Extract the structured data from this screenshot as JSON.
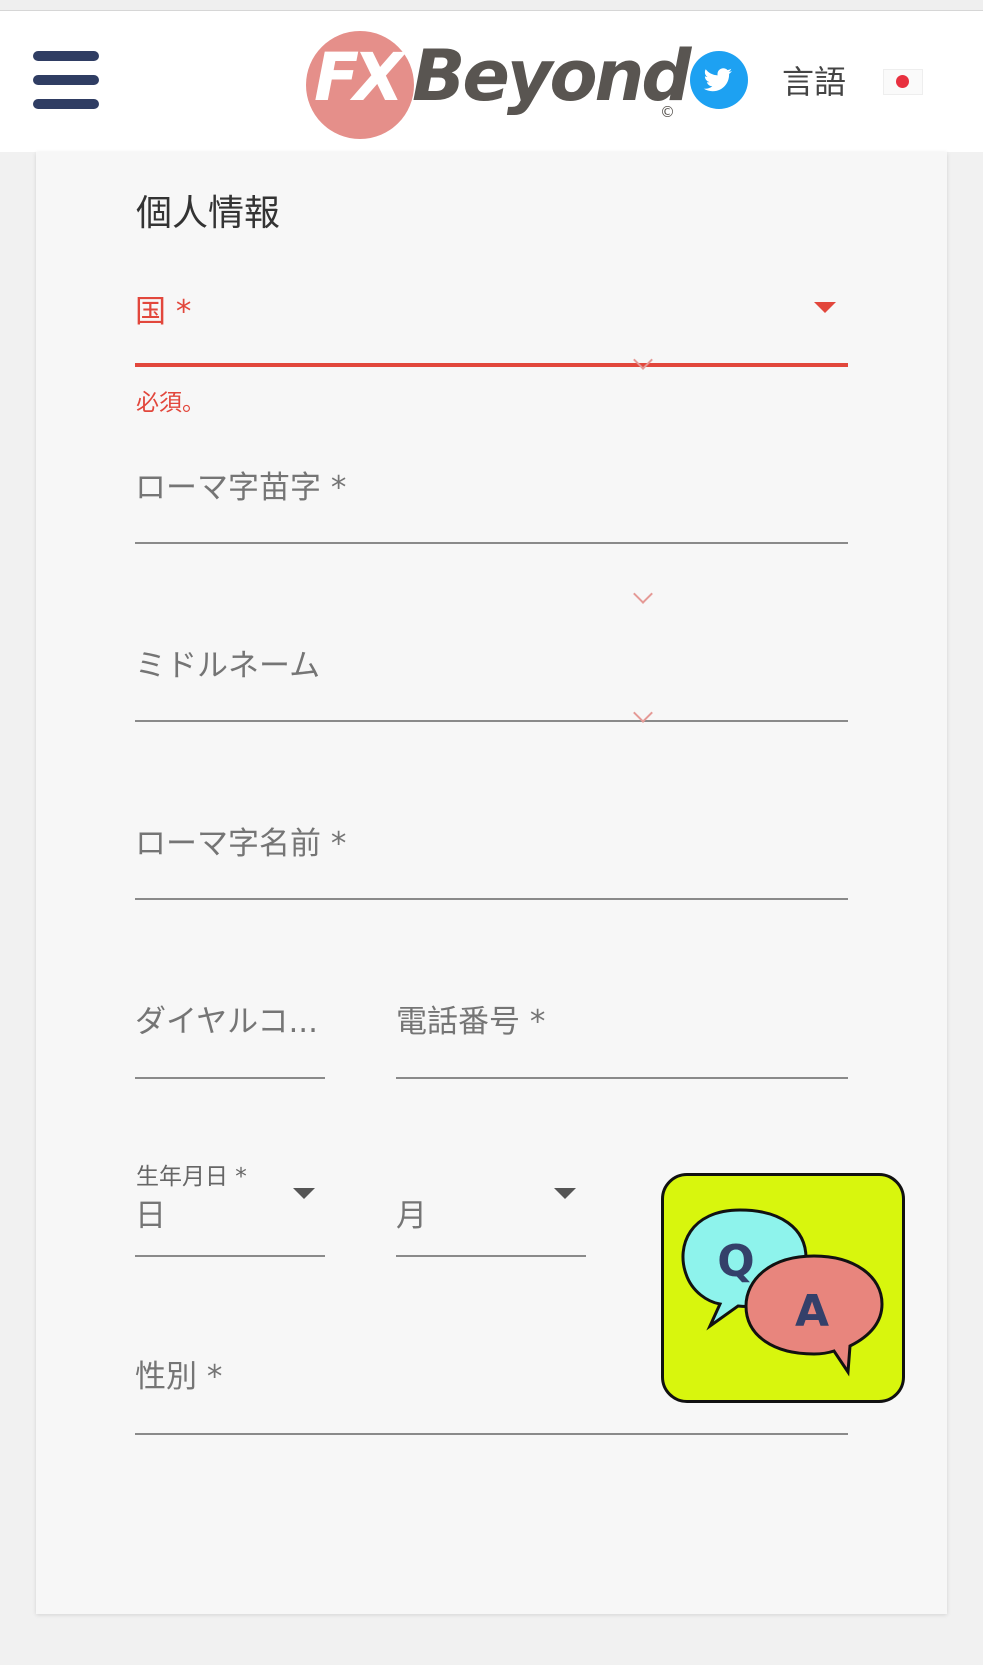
{
  "header": {
    "logo_fx": "FX",
    "logo_beyond": "Beyond",
    "logo_copyright": "©",
    "language_label": "言語",
    "twitter_icon": "twitter-bird-icon",
    "flag_icon": "japan-flag-icon"
  },
  "form": {
    "section_title": "個人情報",
    "country": {
      "label": "国 *",
      "error": "必須。"
    },
    "last_name": {
      "label": "ローマ字苗字 *"
    },
    "middle_name": {
      "label": "ミドルネーム"
    },
    "first_name": {
      "label": "ローマ字名前 *"
    },
    "dial_code": {
      "label": "ダイヤルコ..."
    },
    "phone": {
      "label": "電話番号 *"
    },
    "birthdate": {
      "label": "生年月日 *",
      "day_placeholder": "日",
      "month_placeholder": "月"
    },
    "gender": {
      "label": "性別 *"
    }
  },
  "qa_widget": {
    "q": "Q",
    "a": "A"
  },
  "colors": {
    "accent_error": "#e2473c",
    "hamburger": "#2f3d63",
    "logo_pink": "#e58f8a",
    "qa_background": "#d8f60d",
    "qa_q_bubble": "#8ef3ec",
    "qa_a_bubble": "#e8857d"
  }
}
